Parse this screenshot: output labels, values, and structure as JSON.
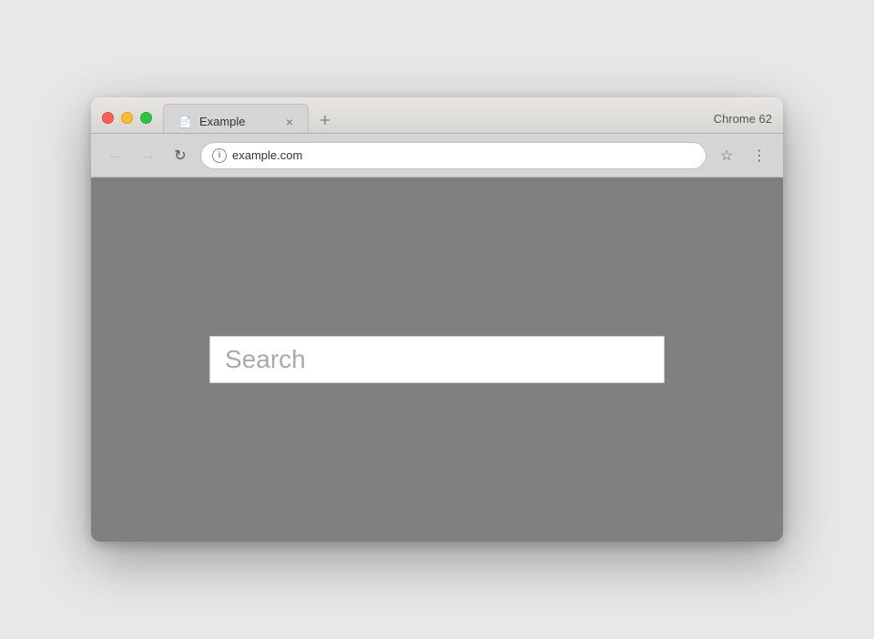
{
  "browser": {
    "chrome_label": "Chrome 62",
    "tab": {
      "title": "Example",
      "icon": "📄"
    },
    "address": "example.com",
    "nav": {
      "back_label": "←",
      "forward_label": "→",
      "reload_label": "↻"
    }
  },
  "page": {
    "search_placeholder": "Search"
  },
  "controls": {
    "close": "×",
    "tab_close": "×",
    "star": "☆",
    "menu": "⋮",
    "info": "i"
  }
}
